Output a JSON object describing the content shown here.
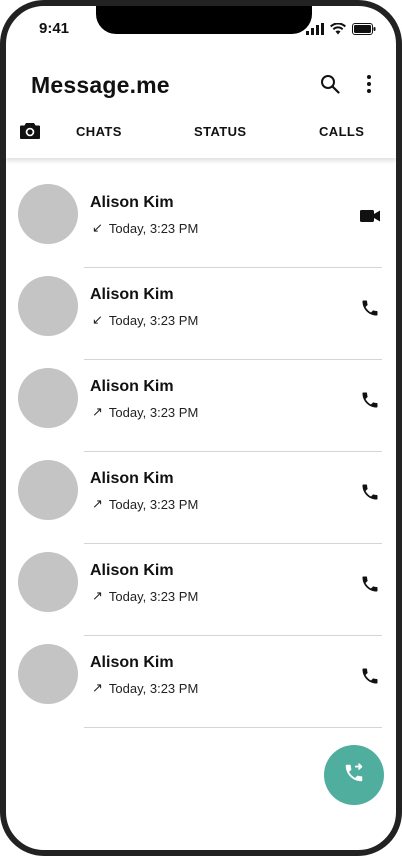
{
  "status_bar": {
    "time": "9:41"
  },
  "header": {
    "title": "Message.me",
    "icons": [
      "search-icon",
      "more-vert-icon"
    ]
  },
  "tabs": [
    {
      "label": "CHATS"
    },
    {
      "label": "STATUS"
    },
    {
      "label": "CALLS"
    }
  ],
  "calls": [
    {
      "name": "Alison Kim",
      "direction": "incoming",
      "direction_glyph": "↙",
      "time": "Today, 3:23 PM",
      "type": "video"
    },
    {
      "name": "Alison Kim",
      "direction": "incoming",
      "direction_glyph": "↙",
      "time": "Today, 3:23 PM",
      "type": "voice"
    },
    {
      "name": "Alison Kim",
      "direction": "outgoing",
      "direction_glyph": "↗",
      "time": "Today, 3:23 PM",
      "type": "voice"
    },
    {
      "name": "Alison Kim",
      "direction": "outgoing",
      "direction_glyph": "↗",
      "time": "Today, 3:23 PM",
      "type": "voice"
    },
    {
      "name": "Alison Kim",
      "direction": "outgoing",
      "direction_glyph": "↗",
      "time": "Today, 3:23 PM",
      "type": "voice"
    },
    {
      "name": "Alison Kim",
      "direction": "outgoing",
      "direction_glyph": "↗",
      "time": "Today, 3:23 PM",
      "type": "voice"
    }
  ],
  "colors": {
    "fab": "#4fae9e",
    "avatar": "#c4c4c4"
  }
}
